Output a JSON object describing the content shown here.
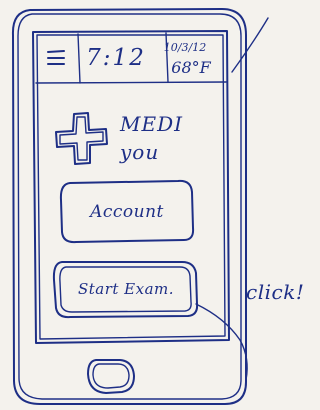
{
  "status_bar": {
    "menu_icon": "hamburger-menu-icon",
    "time": "7:12",
    "date": "10/3/12",
    "temperature": "68°F"
  },
  "logo": {
    "icon": "medical-cross-icon",
    "line1": "MEDI",
    "line2": "you"
  },
  "buttons": {
    "account": "Account",
    "start_exam": "Start Exam."
  },
  "annotation": {
    "text": "click!"
  },
  "colors": {
    "ink": "#1e2f86",
    "paper": "#f4f2ed"
  }
}
